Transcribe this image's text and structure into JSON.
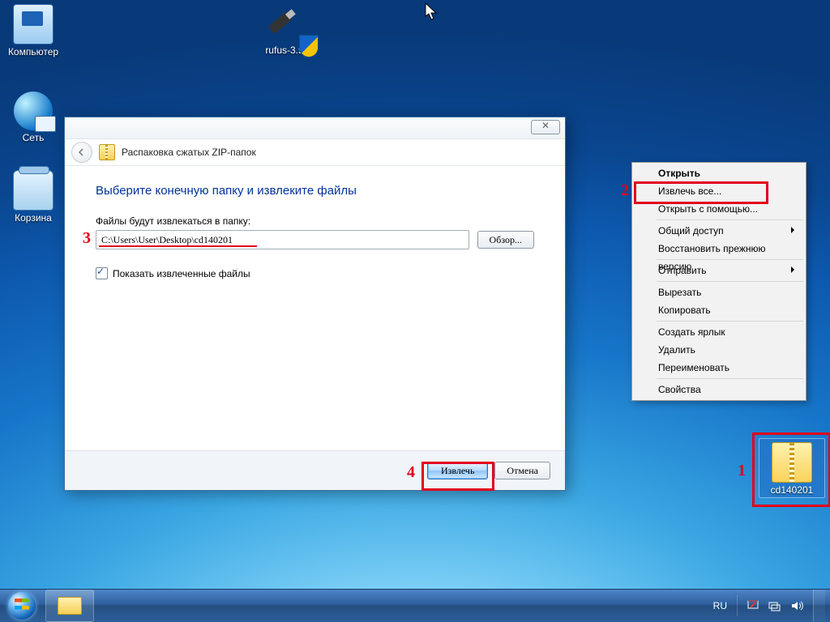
{
  "desktop": {
    "icons": {
      "computer": "Компьютер",
      "network": "Сеть",
      "recycle": "Корзина",
      "rufus": "rufus-3.5",
      "zip": "cd140201"
    }
  },
  "wizard": {
    "title": "Распаковка сжатых ZIP-папок",
    "heading": "Выберите конечную папку и извлеките файлы",
    "dest_label": "Файлы будут извлекаться в папку:",
    "path": "C:\\Users\\User\\Desktop\\cd140201",
    "browse": "Обзор...",
    "show_files": "Показать извлеченные файлы",
    "show_checked": true,
    "extract": "Извлечь",
    "cancel": "Отмена",
    "close_glyph": "✕"
  },
  "context_menu": {
    "items": [
      "Открыть",
      "Извлечь все...",
      "Открыть с помощью...",
      "Общий доступ",
      "Восстановить прежнюю версию",
      "Отправить",
      "Вырезать",
      "Копировать",
      "Создать ярлык",
      "Удалить",
      "Переименовать",
      "Свойства"
    ]
  },
  "taskbar": {
    "lang": "RU"
  },
  "annotations": {
    "n1": "1",
    "n2": "2",
    "n3": "3",
    "n4": "4"
  }
}
